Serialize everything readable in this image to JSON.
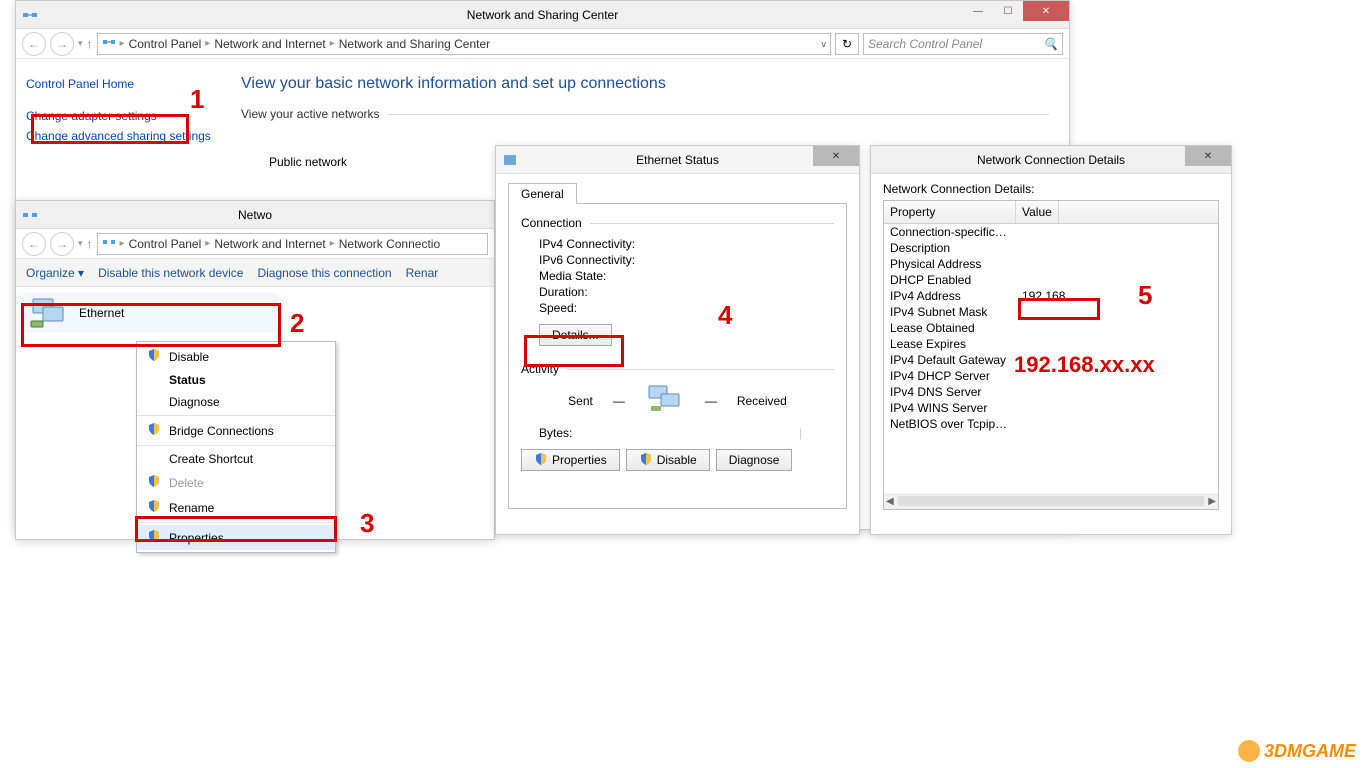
{
  "window_main": {
    "title": "Network and Sharing Center",
    "breadcrumbs": [
      "Control Panel",
      "Network and Internet",
      "Network and Sharing Center"
    ],
    "search_placeholder": "Search Control Panel",
    "side": {
      "home": "Control Panel Home",
      "adapter": "Change adapter settings",
      "advanced": "Change advanced sharing settings"
    },
    "heading": "View your basic network information and set up connections",
    "active_networks_label": "View your active networks",
    "public_network": "Public network"
  },
  "window_conn": {
    "title": "Netwo",
    "breadcrumbs": [
      "Control Panel",
      "Network and Internet",
      "Network Connectio"
    ],
    "toolbar": {
      "organize": "Organize",
      "disable": "Disable this network device",
      "diagnose": "Diagnose this connection",
      "rename": "Renar"
    },
    "tile_name": "Ethernet"
  },
  "context_menu": {
    "items": [
      {
        "label": "Disable",
        "shield": true
      },
      {
        "label": "Status",
        "bold": true
      },
      {
        "label": "Diagnose"
      },
      {
        "sep": true
      },
      {
        "label": "Bridge Connections",
        "shield": true
      },
      {
        "sep": true
      },
      {
        "label": "Create Shortcut"
      },
      {
        "label": "Delete",
        "shield": true,
        "disabled": true
      },
      {
        "label": "Rename",
        "shield": true
      },
      {
        "sep": true
      },
      {
        "label": "Properties",
        "shield": true,
        "hover": true
      }
    ]
  },
  "window_status": {
    "title": "Ethernet Status",
    "tab": "General",
    "connection_label": "Connection",
    "rows": {
      "ipv4": "IPv4 Connectivity:",
      "ipv6": "IPv6 Connectivity:",
      "media": "Media State:",
      "duration": "Duration:",
      "speed": "Speed:"
    },
    "details_btn": "Details...",
    "activity_label": "Activity",
    "sent": "Sent",
    "received": "Received",
    "bytes": "Bytes:",
    "btn_properties": "Properties",
    "btn_disable": "Disable",
    "btn_diagnose": "Diagnose"
  },
  "window_details": {
    "title": "Network Connection Details",
    "subtitle": "Network Connection Details:",
    "col_property": "Property",
    "col_value": "Value",
    "rows": [
      {
        "p": "Connection-specific DN...",
        "v": ""
      },
      {
        "p": "Description",
        "v": ""
      },
      {
        "p": "Physical Address",
        "v": ""
      },
      {
        "p": "DHCP Enabled",
        "v": ""
      },
      {
        "p": "IPv4 Address",
        "v": "192.168."
      },
      {
        "p": "IPv4 Subnet Mask",
        "v": ""
      },
      {
        "p": "Lease Obtained",
        "v": ""
      },
      {
        "p": "Lease Expires",
        "v": ""
      },
      {
        "p": "IPv4 Default Gateway",
        "v": ""
      },
      {
        "p": "IPv4 DHCP Server",
        "v": ""
      },
      {
        "p": "IPv4 DNS Server",
        "v": ""
      },
      {
        "p": "IPv4 WINS Server",
        "v": ""
      },
      {
        "p": "NetBIOS over Tcpip En...",
        "v": ""
      }
    ]
  },
  "annotations": {
    "n1": "1",
    "n2": "2",
    "n3": "3",
    "n4": "4",
    "n5": "5",
    "ip_hint": "192.168.xx.xx"
  },
  "watermark": "3DMGAME"
}
